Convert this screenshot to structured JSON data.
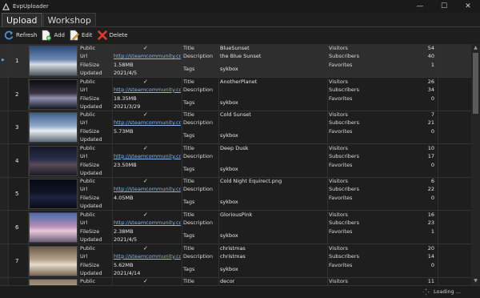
{
  "window": {
    "title": "EvpUploader",
    "minimize": "—",
    "maximize": "☐",
    "close": "✕"
  },
  "tabs": [
    {
      "label": "Upload"
    },
    {
      "label": "Workshop"
    }
  ],
  "toolbar": {
    "refresh": "Refresh",
    "add": "Add",
    "edit": "Edit",
    "delete": "Delete"
  },
  "labels": {
    "public": "Public",
    "url": "Url",
    "filesize": "FileSize",
    "updated": "Updated",
    "title": "Title",
    "description": "Description",
    "tags": "Tags",
    "visitors": "Visitors",
    "subscribers": "Subscribers",
    "favorites": "Favorites"
  },
  "rows": [
    {
      "num": "1",
      "public": true,
      "url": "http://steamcommunity.com...",
      "filesize": "1.58MB",
      "updated": "2021/4/5",
      "title": "BlueSunset",
      "description": "the Blue Sunset",
      "tags": "sykbox",
      "visitors": "54",
      "subscribers": "40",
      "favorites": "1",
      "selected": true,
      "thumb": [
        "#2b4a7a",
        "#6d88b3",
        "#d9dde3",
        "#4e5a63"
      ]
    },
    {
      "num": "2",
      "public": true,
      "url": "http://steamcommunity.com...",
      "filesize": "18.35MB",
      "updated": "2021/3/29",
      "title": "AnotherPlanet",
      "description": "",
      "tags": "sykbox",
      "visitors": "26",
      "subscribers": "34",
      "favorites": "0",
      "selected": false,
      "thumb": [
        "#0b0d14",
        "#3a3240",
        "#8f8fb0",
        "#151820"
      ]
    },
    {
      "num": "3",
      "public": true,
      "url": "http://steamcommunity.com...",
      "filesize": "5.73MB",
      "updated": "",
      "title": "Cold Sunset",
      "description": "",
      "tags": "sykbox",
      "visitors": "7",
      "subscribers": "21",
      "favorites": "0",
      "selected": false,
      "thumb": [
        "#3d5d8c",
        "#8fa9c9",
        "#e8ecef",
        "#5a6a78"
      ]
    },
    {
      "num": "4",
      "public": true,
      "url": "http://steamcommunity.com...",
      "filesize": "23.50MB",
      "updated": "",
      "title": "Deep Dusk",
      "description": "",
      "tags": "sykbox",
      "visitors": "10",
      "subscribers": "17",
      "favorites": "0",
      "selected": false,
      "thumb": [
        "#141828",
        "#2a2f4a",
        "#5b4a5a",
        "#1a1c24"
      ]
    },
    {
      "num": "5",
      "public": true,
      "url": "http://steamcommunity.com...",
      "filesize": "4.05MB",
      "updated": "",
      "title": "Cold Night Equirect.png",
      "description": "",
      "tags": "sykbox",
      "visitors": "6",
      "subscribers": "22",
      "favorites": "0",
      "selected": false,
      "thumb": [
        "#070a14",
        "#0f1426",
        "#1c2440",
        "#0a0c14"
      ]
    },
    {
      "num": "6",
      "public": true,
      "url": "http://steamcommunity.com...",
      "filesize": "2.38MB",
      "updated": "2021/4/5",
      "title": "GloriousPink",
      "description": "",
      "tags": "sykbox",
      "visitors": "16",
      "subscribers": "23",
      "favorites": "1",
      "selected": false,
      "thumb": [
        "#4d6aa6",
        "#b08cb8",
        "#e9c9d6",
        "#6a5d7a"
      ]
    },
    {
      "num": "7",
      "public": true,
      "url": "http://steamcommunity.com...",
      "filesize": "5.62MB",
      "updated": "2021/4/14",
      "title": "christmas",
      "description": "christmas",
      "tags": "sykbox",
      "visitors": "20",
      "subscribers": "14",
      "favorites": "0",
      "selected": false,
      "thumb": [
        "#6b5a48",
        "#b8a48c",
        "#e4dccd",
        "#7a6452"
      ]
    },
    {
      "num": "",
      "public": true,
      "url": "",
      "filesize": "",
      "updated": "",
      "title": "decor",
      "description": "",
      "tags": "",
      "visitors": "11",
      "subscribers": "",
      "favorites": "",
      "selected": false,
      "thumb": [
        "#8a7a66",
        "#c8b89e",
        "#e8dccb",
        "#9a8670"
      ]
    }
  ],
  "status": {
    "text": "Loading ..."
  },
  "colors": {
    "accent": "#5ab0e8",
    "link": "#8ab8ef",
    "background": "#1e1e1e"
  }
}
